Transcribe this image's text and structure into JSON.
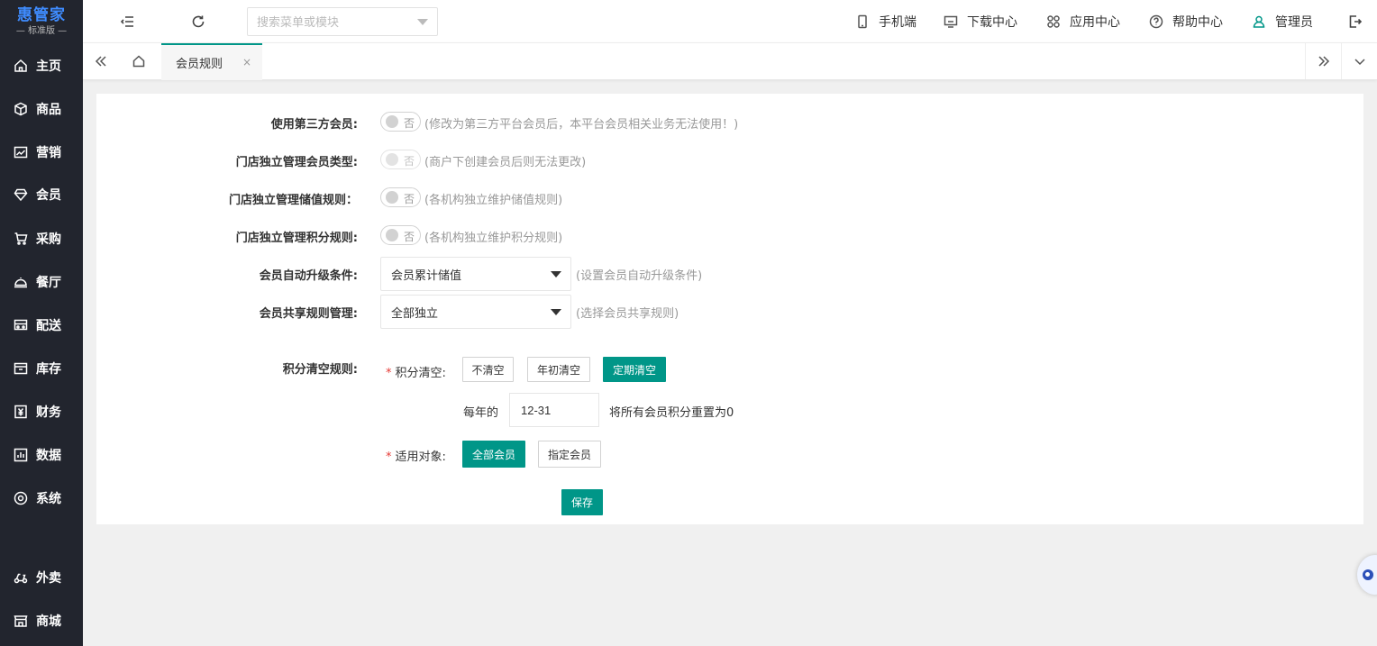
{
  "app": {
    "logo_main": "惠管家",
    "logo_sub": "— 标准版 —"
  },
  "sidebar": {
    "items": [
      {
        "label": "主页",
        "icon": "home-icon"
      },
      {
        "label": "商品",
        "icon": "cube-icon"
      },
      {
        "label": "营销",
        "icon": "chart-icon"
      },
      {
        "label": "会员",
        "icon": "diamond-icon"
      },
      {
        "label": "采购",
        "icon": "cart-icon"
      },
      {
        "label": "餐厅",
        "icon": "cloche-icon"
      },
      {
        "label": "配送",
        "icon": "truck-icon"
      },
      {
        "label": "库存",
        "icon": "box-icon"
      },
      {
        "label": "财务",
        "icon": "money-icon"
      },
      {
        "label": "数据",
        "icon": "bar-chart-icon"
      },
      {
        "label": "系统",
        "icon": "target-icon"
      },
      {
        "label": "外卖",
        "icon": "scooter-icon"
      },
      {
        "label": "商城",
        "icon": "store-icon"
      }
    ]
  },
  "topbar": {
    "search_placeholder": "搜索菜单或模块",
    "links": {
      "mobile": "手机端",
      "download": "下载中心",
      "apps": "应用中心",
      "help": "帮助中心",
      "user": "管理员"
    }
  },
  "tabs": {
    "active_label": "会员规则",
    "close_glyph": "×"
  },
  "form": {
    "third_party": {
      "label": "使用第三方会员:",
      "value": "否",
      "hint": "(修改为第三方平台会员后，本平台会员相关业务无法使用！)"
    },
    "store_member_type": {
      "label": "门店独立管理会员类型:",
      "value": "否",
      "hint": "(商户下创建会员后则无法更改)"
    },
    "store_stored_value": {
      "label": "门店独立管理储值规则：",
      "value": "否",
      "hint": "(各机构独立维护储值规则)"
    },
    "store_points": {
      "label": "门店独立管理积分规则:",
      "value": "否",
      "hint": "(各机构独立维护积分规则)"
    },
    "auto_upgrade": {
      "label": "会员自动升级条件:",
      "selected": "会员累计储值",
      "hint": "(设置会员自动升级条件)"
    },
    "share_rules": {
      "label": "会员共享规则管理:",
      "selected": "全部独立",
      "hint": "(选择会员共享规则)"
    },
    "points_clear": {
      "label": "积分清空规则:",
      "clear_label": "积分清空:",
      "required_mark": "*",
      "options": [
        "不清空",
        "年初清空",
        "定期清空"
      ],
      "active_option": "定期清空",
      "yearly_prefix": "每年的",
      "date_value": "12-31",
      "yearly_suffix": "将所有会员积分重置为0",
      "target_label": "适用对象:",
      "targets": [
        "全部会员",
        "指定会员"
      ],
      "active_target": "全部会员"
    },
    "save_label": "保存"
  },
  "colors": {
    "sidebar_bg": "#22252e",
    "accent": "#009688",
    "logo_blue": "#3f8cff",
    "required_red": "#e53935"
  }
}
